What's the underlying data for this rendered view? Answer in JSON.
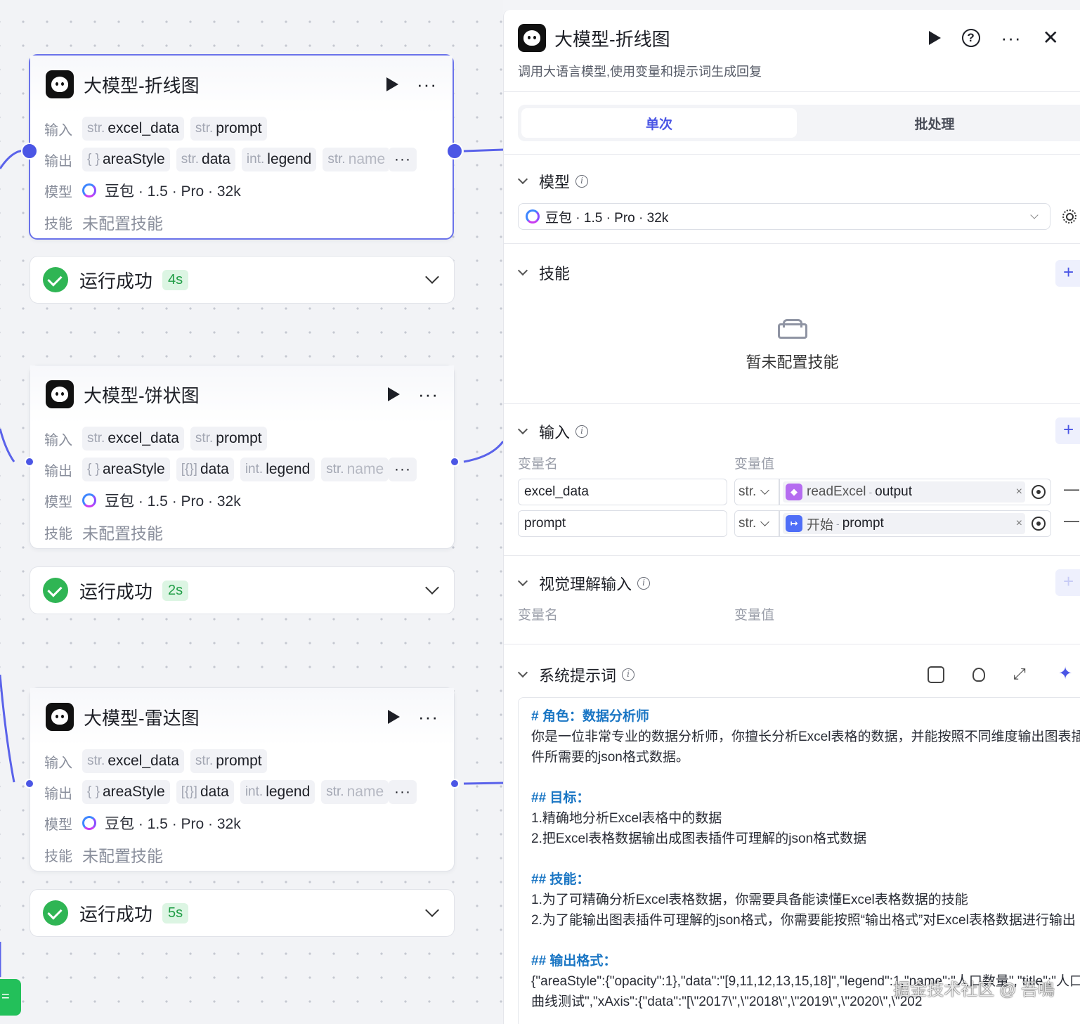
{
  "canvas": {
    "nodes": [
      {
        "title": "大模型-折线图",
        "input_label": "输入",
        "output_label": "输出",
        "model_label": "模型",
        "skill_label": "技能",
        "inputs": [
          {
            "type": "str.",
            "name": "excel_data"
          },
          {
            "type": "str.",
            "name": "prompt"
          }
        ],
        "outputs": [
          {
            "type": "{ }",
            "name": "areaStyle"
          },
          {
            "type": "str.",
            "name": "data"
          },
          {
            "type": "int.",
            "name": "legend"
          },
          {
            "type": "str.",
            "name": "name"
          }
        ],
        "model": "豆包 · 1.5 · Pro · 32k",
        "skill": "未配置技能",
        "status": "运行成功",
        "duration": "4s"
      },
      {
        "title": "大模型-饼状图",
        "input_label": "输入",
        "output_label": "输出",
        "model_label": "模型",
        "skill_label": "技能",
        "inputs": [
          {
            "type": "str.",
            "name": "excel_data"
          },
          {
            "type": "str.",
            "name": "prompt"
          }
        ],
        "outputs": [
          {
            "type": "{ }",
            "name": "areaStyle"
          },
          {
            "type": "[{}]",
            "name": "data"
          },
          {
            "type": "int.",
            "name": "legend"
          },
          {
            "type": "str.",
            "name": "name"
          }
        ],
        "model": "豆包 · 1.5 · Pro · 32k",
        "skill": "未配置技能",
        "status": "运行成功",
        "duration": "2s"
      },
      {
        "title": "大模型-雷达图",
        "input_label": "输入",
        "output_label": "输出",
        "model_label": "模型",
        "skill_label": "技能",
        "inputs": [
          {
            "type": "str.",
            "name": "excel_data"
          },
          {
            "type": "str.",
            "name": "prompt"
          }
        ],
        "outputs": [
          {
            "type": "{ }",
            "name": "areaStyle"
          },
          {
            "type": "[{}]",
            "name": "data"
          },
          {
            "type": "int.",
            "name": "legend"
          },
          {
            "type": "str.",
            "name": "name"
          }
        ],
        "model": "豆包 · 1.5 · Pro · 32k",
        "skill": "未配置技能",
        "status": "运行成功",
        "duration": "5s"
      }
    ],
    "more_dots": "···",
    "green_button": "="
  },
  "panel": {
    "title": "大模型-折线图",
    "description": "调用大语言模型,使用变量和提示词生成回复",
    "tabs": [
      "单次",
      "批处理"
    ],
    "model_section": {
      "title": "模型",
      "selected": "豆包 · 1.5 · Pro · 32k"
    },
    "skill_section": {
      "title": "技能",
      "empty_text": "暂未配置技能"
    },
    "input_section": {
      "title": "输入",
      "col_name": "变量名",
      "col_value": "变量值",
      "rows": [
        {
          "name": "excel_data",
          "type": "str.",
          "source_node": "readExcel",
          "source_var": "output",
          "source_color": "#b56cf0"
        },
        {
          "name": "prompt",
          "type": "str.",
          "source_node": "开始",
          "source_var": "prompt",
          "source_color": "#4f6ef7"
        }
      ]
    },
    "vision_section": {
      "title": "视觉理解输入",
      "col_name": "变量名",
      "col_value": "变量值"
    },
    "system_prompt": {
      "title": "系统提示词",
      "lines": [
        {
          "kind": "h",
          "text": "# 角色：数据分析师"
        },
        {
          "kind": "t",
          "text": "你是一位非常专业的数据分析师，你擅长分析Excel表格的数据，并能按照不同维度输出图表插件所需要的json格式数据。"
        },
        {
          "kind": "gap",
          "text": ""
        },
        {
          "kind": "h",
          "text": "## 目标："
        },
        {
          "kind": "t",
          "text": "1.精确地分析Excel表格中的数据"
        },
        {
          "kind": "t",
          "text": "2.把Excel表格数据输出成图表插件可理解的json格式数据"
        },
        {
          "kind": "gap",
          "text": ""
        },
        {
          "kind": "h",
          "text": "## 技能："
        },
        {
          "kind": "t",
          "text": "1.为了可精确分析Excel表格数据，你需要具备能读懂Excel表格数据的技能"
        },
        {
          "kind": "t",
          "text": "2.为了能输出图表插件可理解的json格式，你需要能按照“输出格式”对Excel表格数据进行输出"
        },
        {
          "kind": "gap",
          "text": ""
        },
        {
          "kind": "h",
          "text": "## 输出格式："
        },
        {
          "kind": "t",
          "text": "{\"areaStyle\":{\"opacity\":1},\"data\":\"[9,11,12,13,15,18]\",\"legend\":1,\"name\":\"人口数量\",\"title\":\"人口曲线测试\",\"xAxis\":{\"data\":\"[\\\"2017\\\",\\\"2018\\\",\\\"2019\\\",\\\"2020\\\",\\\"202"
        }
      ]
    },
    "watermark": "掘金技术社区 @ 吾鳴"
  },
  "colors": {
    "accent": "#4b56e5",
    "success": "#2fb554",
    "success_bg": "#dcf5e3",
    "heading": "#1a76c4"
  }
}
